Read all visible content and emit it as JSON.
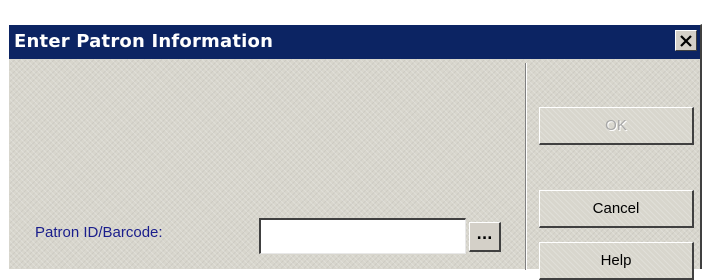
{
  "window": {
    "title": "Enter Patron Information"
  },
  "form": {
    "patron_label": "Patron ID/Barcode:",
    "patron_value": "",
    "browse_label": "..."
  },
  "buttons": {
    "ok": "OK",
    "cancel": "Cancel",
    "help": "Help"
  },
  "icons": {
    "close": "close-icon"
  },
  "colors": {
    "titlebar": "#0c2463",
    "label_text": "#1a1e8c",
    "dialog_bg": "#d8d6cd"
  }
}
